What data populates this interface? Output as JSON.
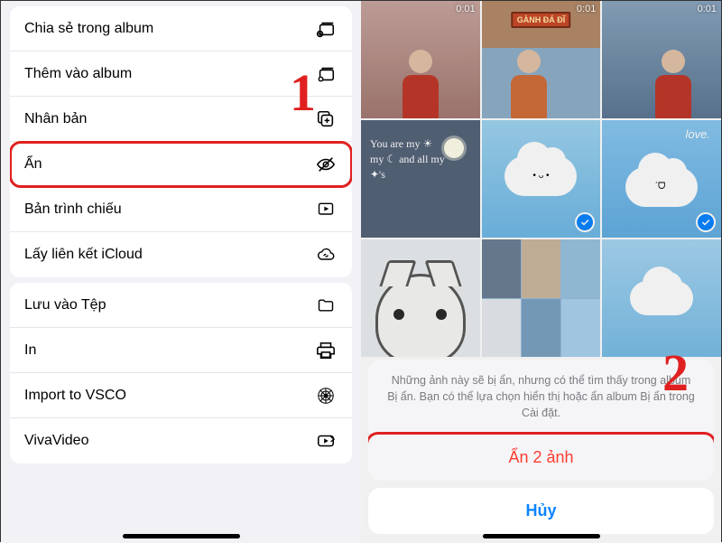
{
  "left": {
    "group1": [
      {
        "label": "Chia sẻ trong album",
        "icon": "album-share-icon"
      },
      {
        "label": "Thêm vào album",
        "icon": "album-add-icon"
      },
      {
        "label": "Nhân bản",
        "icon": "duplicate-icon"
      },
      {
        "label": "Ẩn",
        "icon": "hide-icon",
        "highlighted": true
      },
      {
        "label": "Bản trình chiếu",
        "icon": "slideshow-icon"
      },
      {
        "label": "Lấy liên kết iCloud",
        "icon": "icloud-link-icon"
      }
    ],
    "group2": [
      {
        "label": "Lưu vào Tệp",
        "icon": "folder-icon"
      },
      {
        "label": "In",
        "icon": "print-icon"
      },
      {
        "label": "Import to VSCO",
        "icon": "vsco-icon"
      },
      {
        "label": "VivaVideo",
        "icon": "vivavideo-icon"
      }
    ],
    "step_marker": "1"
  },
  "right": {
    "thumbs": [
      {
        "duration": "0:01"
      },
      {
        "duration": "0:01"
      },
      {
        "duration": "0:01"
      }
    ],
    "doodle_lines": [
      "You are my ☀",
      "my ☾ and all my",
      "✦'s"
    ],
    "love_text": "love.",
    "sign_text": "GÀNH ĐÁ ĐĨ",
    "actionsheet": {
      "message": "Những ảnh này sẽ bị ẩn, nhưng có thể tìm thấy trong album Bị ẩn. Bạn có thể lựa chọn hiển thị hoặc ẩn album Bị ẩn trong Cài đặt.",
      "confirm": "Ẩn 2 ảnh",
      "cancel": "Hủy"
    },
    "step_marker": "2"
  }
}
